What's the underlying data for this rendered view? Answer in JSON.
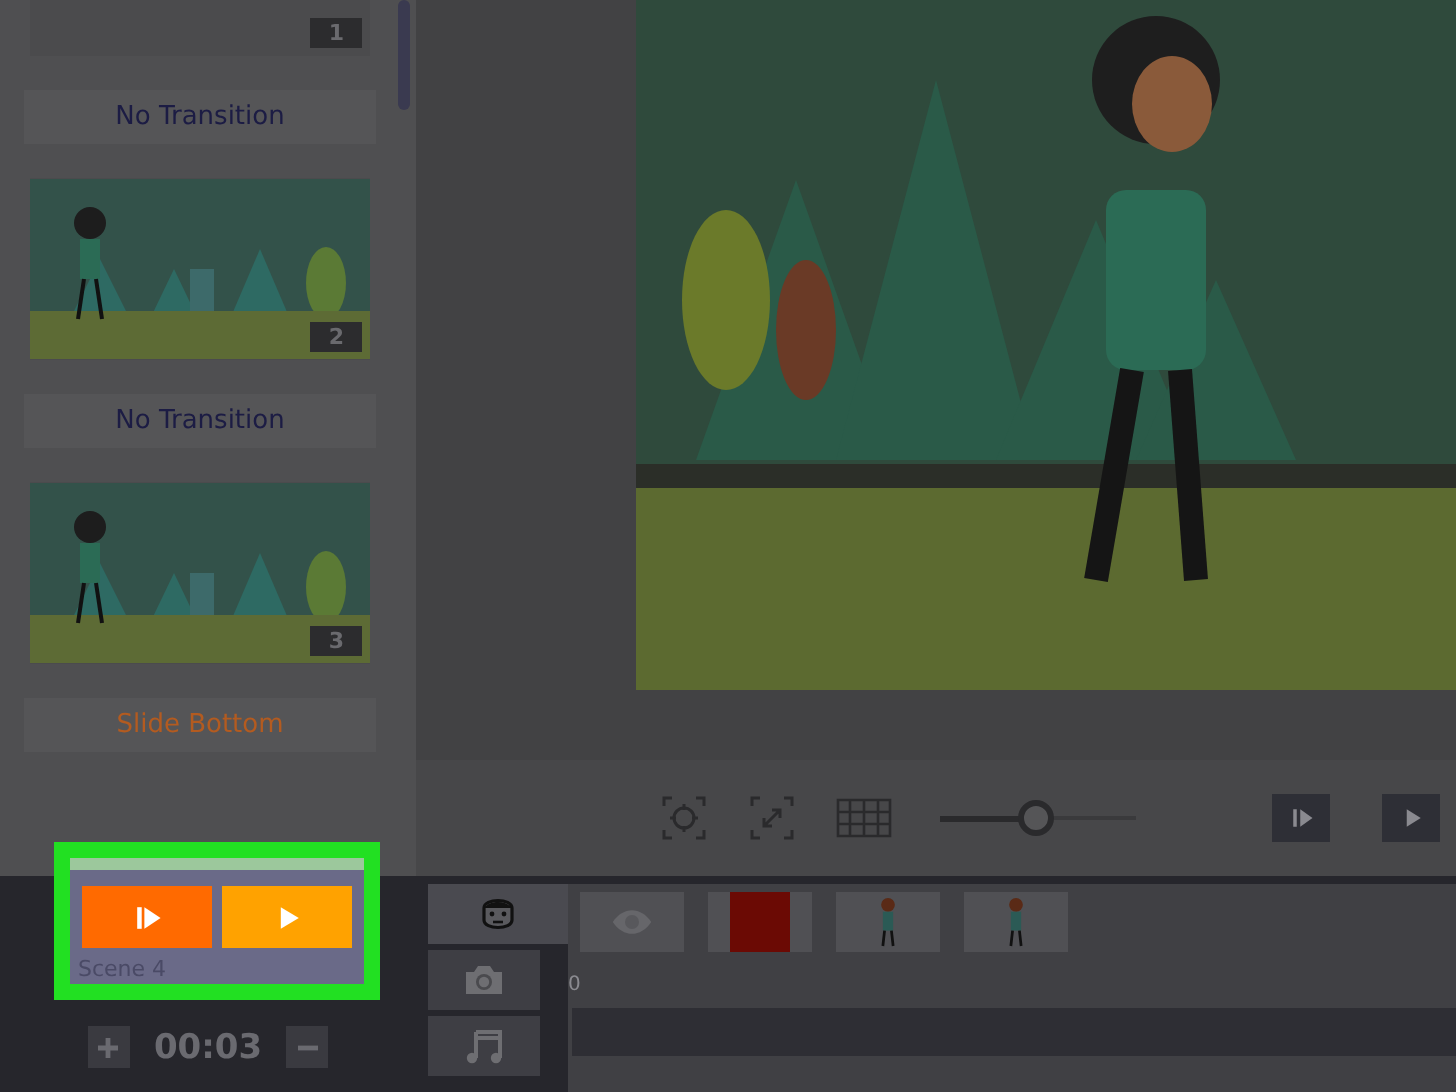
{
  "slide_list": [
    {
      "kind": "slide",
      "number": "1",
      "partial": true
    },
    {
      "kind": "transition",
      "label": "No Transition",
      "active": false
    },
    {
      "kind": "slide",
      "number": "2",
      "partial": false
    },
    {
      "kind": "transition",
      "label": "No Transition",
      "active": false
    },
    {
      "kind": "slide",
      "number": "3",
      "partial": false
    },
    {
      "kind": "transition",
      "label": "Slide Bottom",
      "active": true
    }
  ],
  "preview_toolbar": {
    "zoom_slider": {
      "level": 0.49
    }
  },
  "scene_popup": {
    "scene_label": "Scene 4",
    "duration": "00:03"
  },
  "timeline": {
    "tabs": [
      {
        "kind": "characters",
        "selected": true
      },
      {
        "kind": "camera",
        "selected": false
      },
      {
        "kind": "music",
        "selected": false
      }
    ],
    "items": [
      {
        "kind": "eye"
      },
      {
        "kind": "swatch",
        "color": "#6b0a04"
      },
      {
        "kind": "figure"
      },
      {
        "kind": "figure"
      }
    ],
    "ruler_label": "0"
  }
}
